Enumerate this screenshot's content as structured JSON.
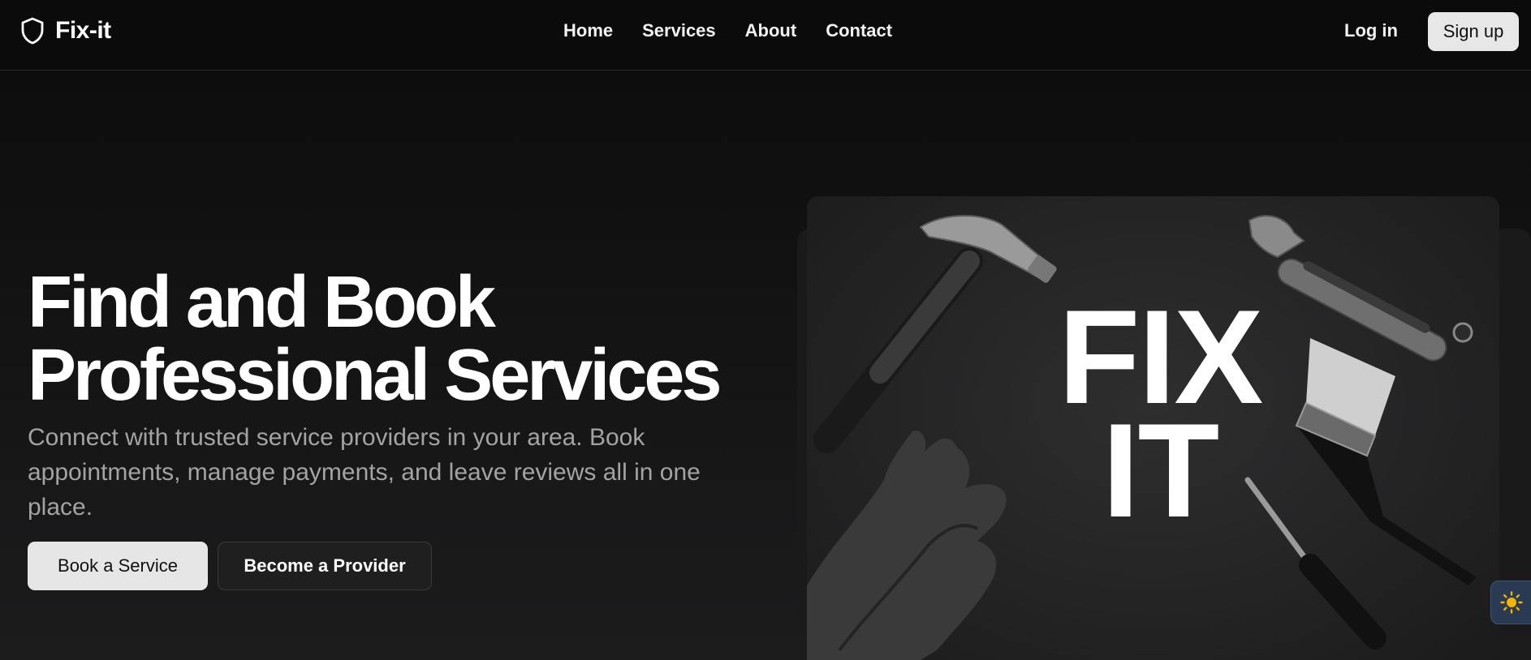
{
  "header": {
    "brand": "Fix-it",
    "nav": [
      "Home",
      "Services",
      "About",
      "Contact"
    ],
    "login_label": "Log in",
    "signup_label": "Sign up"
  },
  "hero": {
    "title_line1": "Find and Book",
    "title_line2": "Professional Services",
    "subtitle": "Connect with trusted service providers in your area. Book appointments, manage payments, and leave reviews all in one place.",
    "primary_button": "Book a Service",
    "secondary_button": "Become a Provider",
    "image_text_line1": "FIX",
    "image_text_line2": "IT"
  },
  "icons": {
    "brand": "shield-icon",
    "theme_toggle": "sun-icon"
  },
  "colors": {
    "background": "#0f0f10",
    "primary_button": "#e6e6e6",
    "theme_toggle_bg": "#2a3a52",
    "sun": "#f5b400"
  }
}
